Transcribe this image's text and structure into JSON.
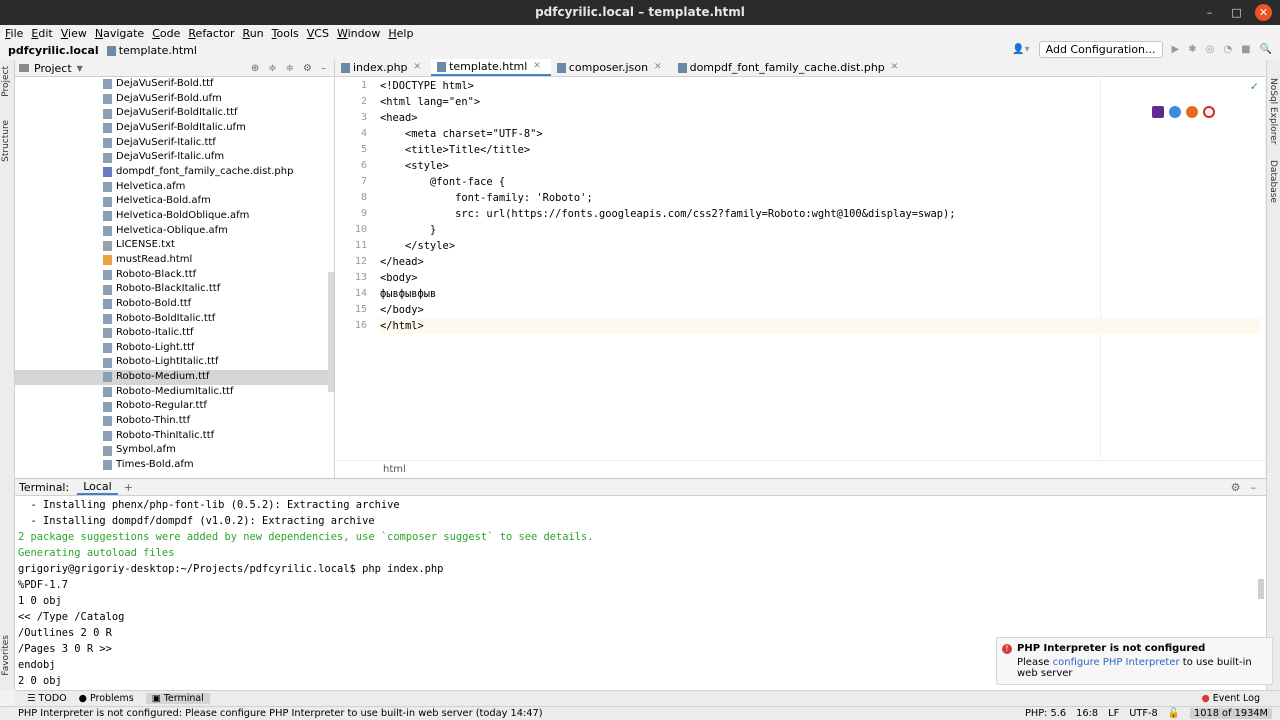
{
  "window": {
    "title": "pdfcyrilic.local – template.html"
  },
  "menu": [
    "File",
    "Edit",
    "View",
    "Navigate",
    "Code",
    "Refactor",
    "Run",
    "Tools",
    "VCS",
    "Window",
    "Help"
  ],
  "nav": {
    "project": "pdfcyrilic.local",
    "file": "template.html",
    "add_config": "Add Configuration..."
  },
  "project_panel": {
    "title": "Project",
    "files": [
      {
        "name": "DejaVuSerif-Bold.ttf",
        "kind": "font"
      },
      {
        "name": "DejaVuSerif-Bold.ufm",
        "kind": "font"
      },
      {
        "name": "DejaVuSerif-BoldItalic.ttf",
        "kind": "font"
      },
      {
        "name": "DejaVuSerif-BoldItalic.ufm",
        "kind": "font"
      },
      {
        "name": "DejaVuSerif-Italic.ttf",
        "kind": "font"
      },
      {
        "name": "DejaVuSerif-Italic.ufm",
        "kind": "font"
      },
      {
        "name": "dompdf_font_family_cache.dist.php",
        "kind": "php"
      },
      {
        "name": "Helvetica.afm",
        "kind": "font"
      },
      {
        "name": "Helvetica-Bold.afm",
        "kind": "font"
      },
      {
        "name": "Helvetica-BoldOblique.afm",
        "kind": "font"
      },
      {
        "name": "Helvetica-Oblique.afm",
        "kind": "font"
      },
      {
        "name": "LICENSE.txt",
        "kind": "txt"
      },
      {
        "name": "mustRead.html",
        "kind": "html"
      },
      {
        "name": "Roboto-Black.ttf",
        "kind": "font"
      },
      {
        "name": "Roboto-BlackItalic.ttf",
        "kind": "font"
      },
      {
        "name": "Roboto-Bold.ttf",
        "kind": "font"
      },
      {
        "name": "Roboto-BoldItalic.ttf",
        "kind": "font"
      },
      {
        "name": "Roboto-Italic.ttf",
        "kind": "font"
      },
      {
        "name": "Roboto-Light.ttf",
        "kind": "font"
      },
      {
        "name": "Roboto-LightItalic.ttf",
        "kind": "font"
      },
      {
        "name": "Roboto-Medium.ttf",
        "kind": "font",
        "selected": true
      },
      {
        "name": "Roboto-MediumItalic.ttf",
        "kind": "font"
      },
      {
        "name": "Roboto-Regular.ttf",
        "kind": "font"
      },
      {
        "name": "Roboto-Thin.ttf",
        "kind": "font"
      },
      {
        "name": "Roboto-ThinItalic.ttf",
        "kind": "font"
      },
      {
        "name": "Symbol.afm",
        "kind": "font"
      },
      {
        "name": "Times-Bold.afm",
        "kind": "font"
      }
    ]
  },
  "editor": {
    "tabs": [
      {
        "label": "index.php",
        "active": false
      },
      {
        "label": "template.html",
        "active": true
      },
      {
        "label": "composer.json",
        "active": false
      },
      {
        "label": "dompdf_font_family_cache.dist.php",
        "active": false
      }
    ],
    "breadcrumb": "html",
    "lines": [
      "<!DOCTYPE html>",
      "<html lang=\"en\">",
      "<head>",
      "    <meta charset=\"UTF-8\">",
      "    <title>Title</title>",
      "    <style>",
      "        @font-face {",
      "            font-family: 'Roboto';",
      "            src: url(https://fonts.googleapis.com/css2?family=Roboto:wght@100&display=swap);",
      "        }",
      "    </style>",
      "</head>",
      "<body>",
      "фывфывфыв",
      "</body>",
      "</html>"
    ]
  },
  "terminal": {
    "label": "Terminal:",
    "tab": "Local",
    "lines": [
      "  - Installing phenx/php-font-lib (0.5.2): Extracting archive",
      "  - Installing dompdf/dompdf (v1.0.2): Extracting archive",
      "2 package suggestions were added by new dependencies, use `composer suggest` to see details.",
      "Generating autoload files",
      "grigoriy@grigoriy-desktop:~/Projects/pdfcyrilic.local$ php index.php",
      "%PDF-1.7",
      "1 0 obj",
      "<< /Type /Catalog",
      "/Outlines 2 0 R",
      "/Pages 3 0 R >>",
      "endobj",
      "2 0 obj"
    ]
  },
  "notification": {
    "title": "PHP Interpreter is not configured",
    "text_pre": "Please ",
    "link": "configure PHP Interpreter",
    "text_post": " to use built-in web server"
  },
  "toolstrip": {
    "todo": "TODO",
    "problems": "Problems",
    "terminal": "Terminal",
    "event_log": "Event Log"
  },
  "status": {
    "message": "PHP Interpreter is not configured: Please configure PHP Interpreter to use built-in web server (today 14:47)",
    "php": "PHP: 5.6",
    "position": "16:8",
    "line_sep": "LF",
    "encoding": "UTF-8",
    "memory": "1018 of 1934M"
  },
  "side_tabs": {
    "project": "Project",
    "structure": "Structure",
    "favorites": "Favorites",
    "nosql": "NoSql Explorer",
    "database": "Database"
  },
  "colors": {
    "accent": "#4083c9",
    "titlebar": "#2b2b2b",
    "close": "#e95420",
    "error": "#d93b3b"
  }
}
